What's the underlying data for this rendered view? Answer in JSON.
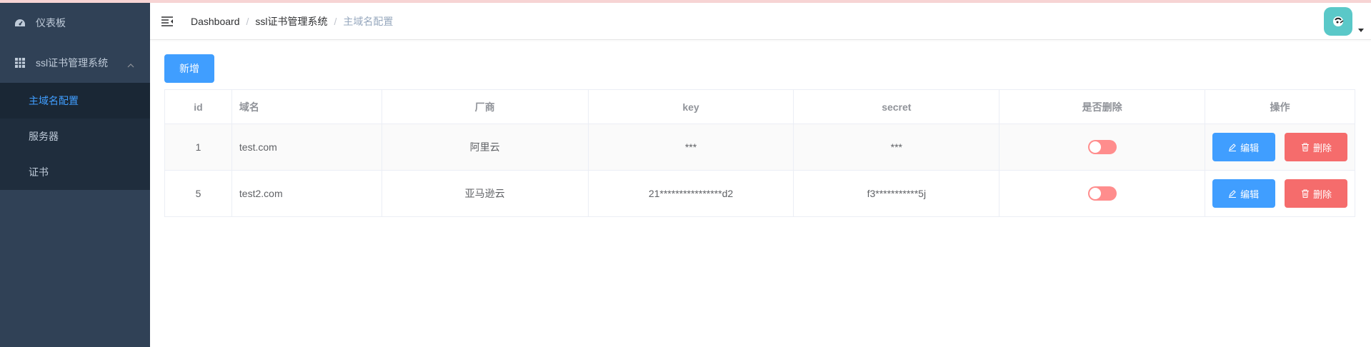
{
  "sidebar": {
    "items": [
      {
        "label": "仪表板",
        "icon": "dashboard-icon"
      },
      {
        "label": "ssl证书管理系统",
        "icon": "grid-icon",
        "expanded": true,
        "children": [
          {
            "label": "主域名配置",
            "active": true
          },
          {
            "label": "服务器",
            "active": false
          },
          {
            "label": "证书",
            "active": false
          }
        ]
      }
    ]
  },
  "breadcrumb": [
    "Dashboard",
    "ssl证书管理系统",
    "主域名配置"
  ],
  "toolbar": {
    "add_label": "新增"
  },
  "table": {
    "columns": [
      "id",
      "域名",
      "厂商",
      "key",
      "secret",
      "是否删除",
      "操作"
    ],
    "rows": [
      {
        "id": "1",
        "domain": "test.com",
        "vendor": "阿里云",
        "key": "***",
        "secret": "***",
        "deleted": false
      },
      {
        "id": "5",
        "domain": "test2.com",
        "vendor": "亚马逊云",
        "key": "21****************d2",
        "secret": "f3***********5j",
        "deleted": false
      }
    ],
    "edit_label": "编辑",
    "delete_label": "删除"
  },
  "colors": {
    "accent": "#409eff",
    "danger": "#f56c6c",
    "sidebar_bg": "#304156",
    "switch_off": "#ff8d8d"
  }
}
